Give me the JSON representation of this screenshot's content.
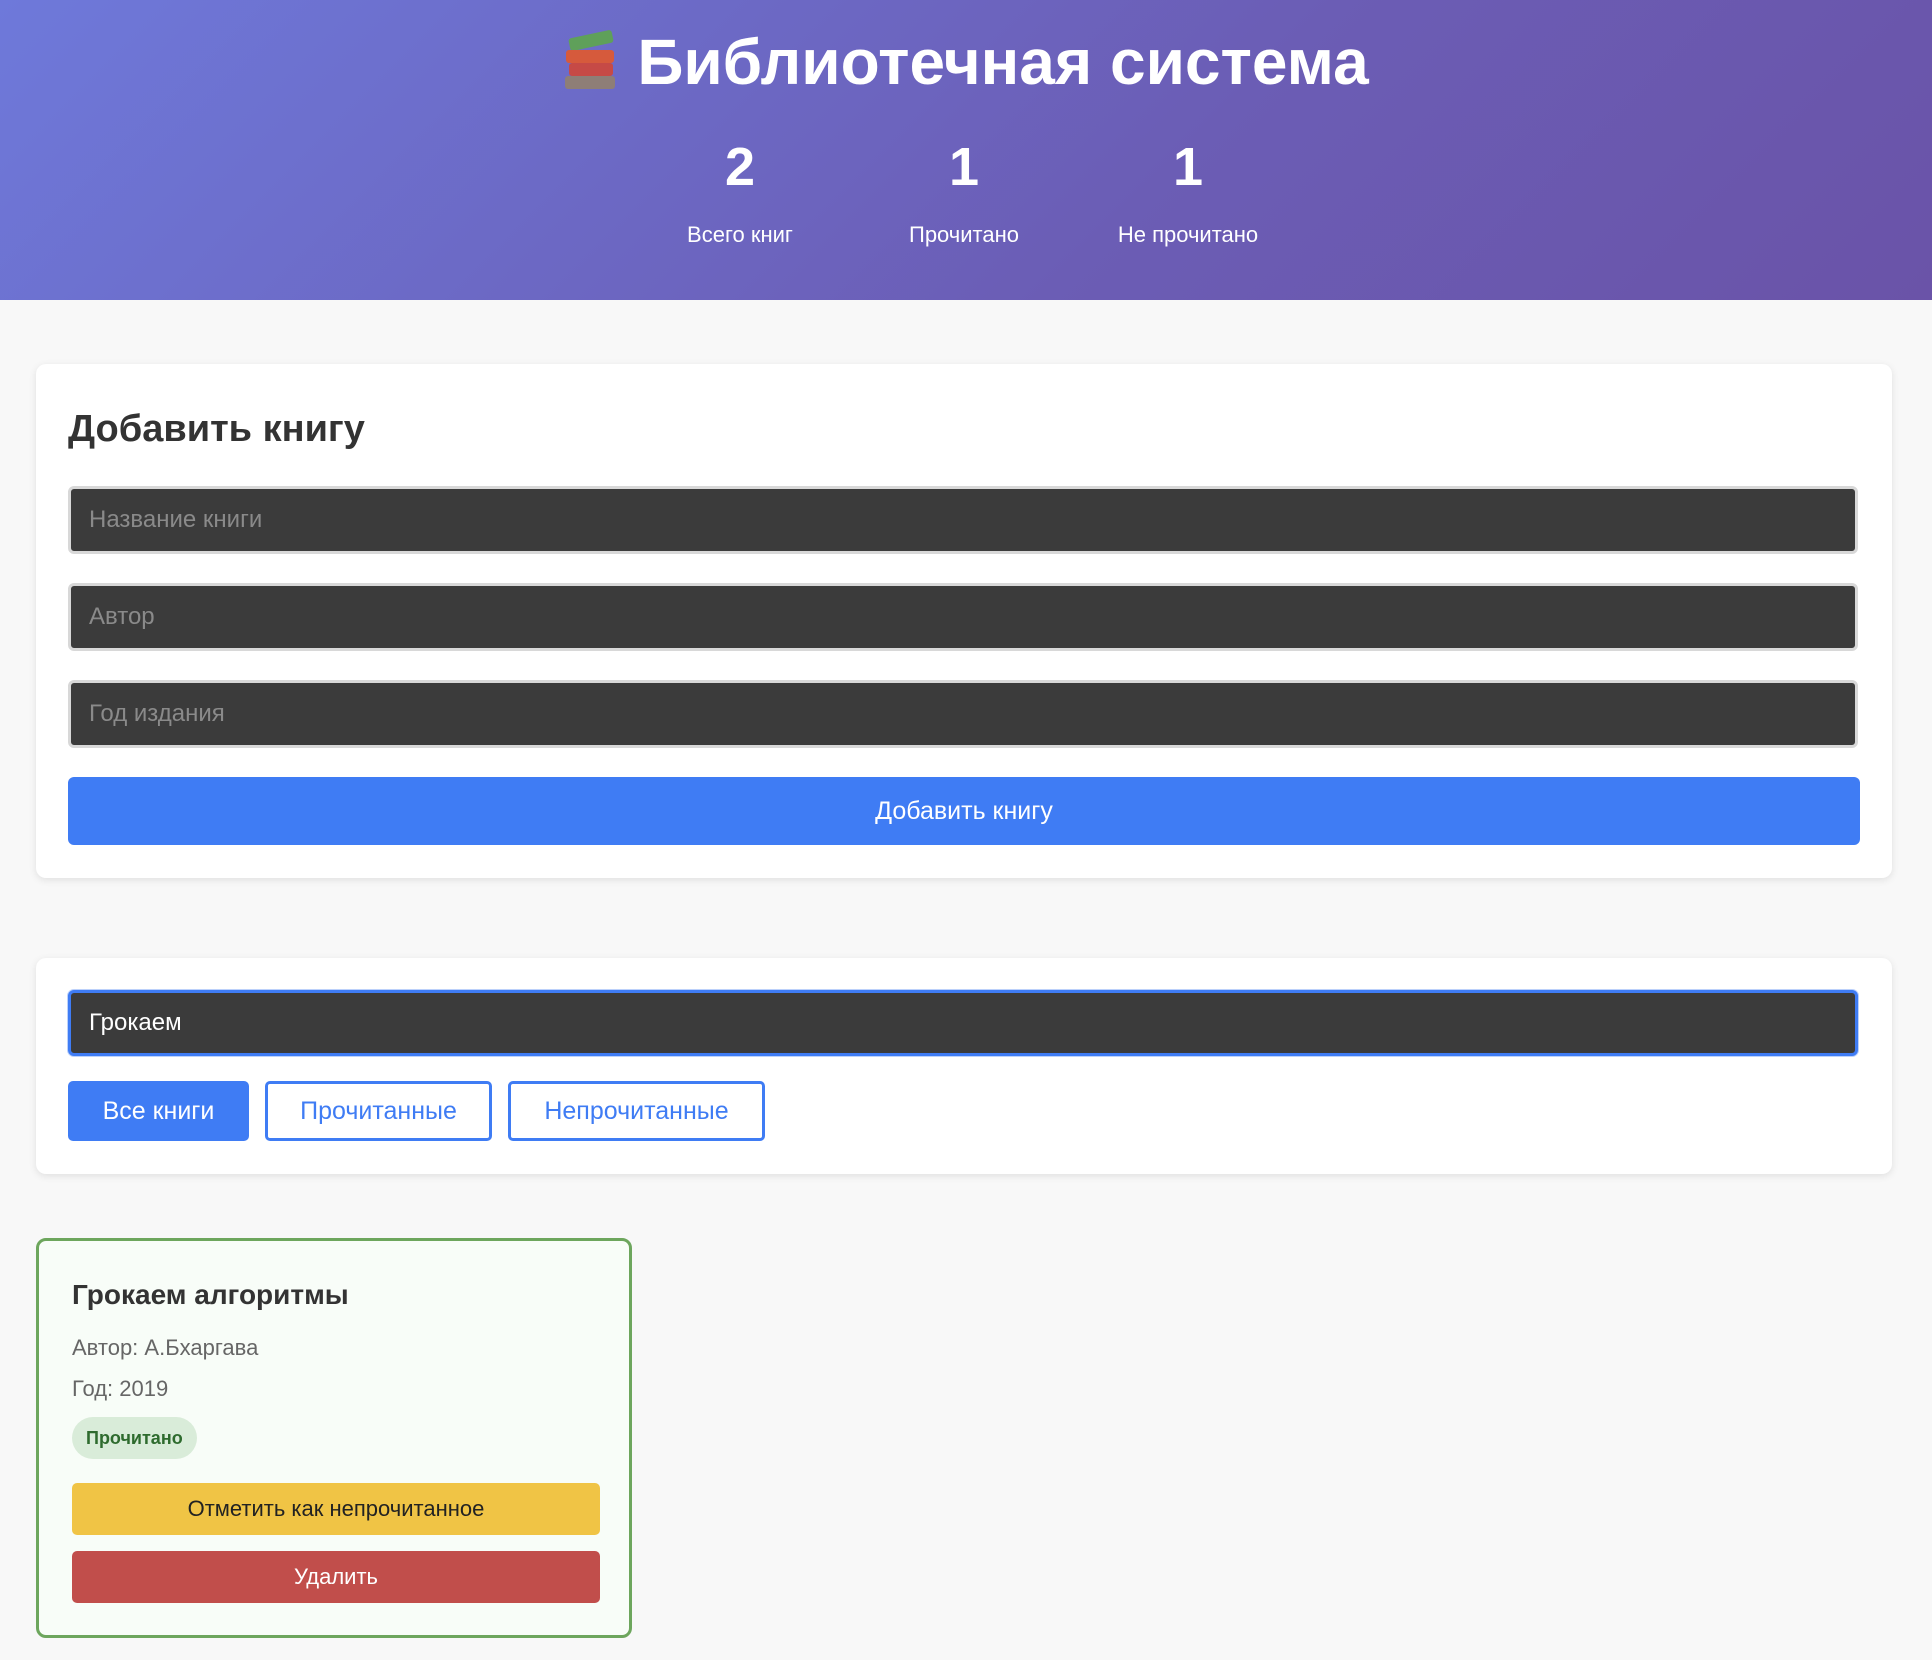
{
  "header": {
    "title": "Библиотечная система",
    "icon": "books-icon",
    "stats": [
      {
        "value": "2",
        "label": "Всего книг"
      },
      {
        "value": "1",
        "label": "Прочитано"
      },
      {
        "value": "1",
        "label": "Не прочитано"
      }
    ]
  },
  "add_form": {
    "title": "Добавить книгу",
    "title_placeholder": "Название книги",
    "author_placeholder": "Автор",
    "year_placeholder": "Год издания",
    "submit_label": "Добавить книгу"
  },
  "filters": {
    "search_value": "Грокаем",
    "buttons": [
      "Все книги",
      "Прочитанные",
      "Непрочитанные"
    ],
    "active": "Все книги"
  },
  "books": [
    {
      "title": "Грокаем алгоритмы",
      "author": "Автор: А.Бхаргава",
      "year": "Год: 2019",
      "status": "Прочитано",
      "toggle_label": "Отметить как непрочитанное",
      "delete_label": "Удалить"
    }
  ],
  "colors": {
    "accent": "#3f7cf4",
    "read_border": "#6da65d",
    "toggle_button": "#f0c445",
    "delete_button": "#c14e4b"
  }
}
